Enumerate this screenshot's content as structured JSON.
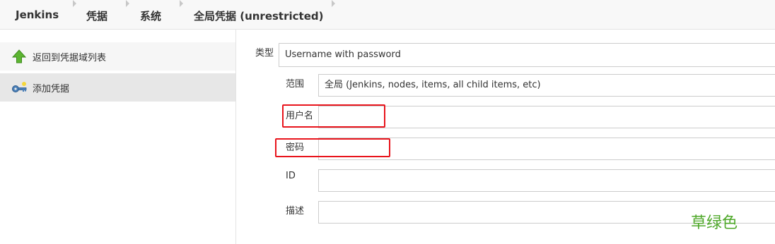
{
  "breadcrumbs": [
    {
      "label": "Jenkins"
    },
    {
      "label": "凭据"
    },
    {
      "label": "系统"
    },
    {
      "label": "全局凭据 (unrestricted)"
    }
  ],
  "sidebar": {
    "items": [
      {
        "label": "返回到凭据域列表",
        "icon": "up-arrow-icon"
      },
      {
        "label": "添加凭据",
        "icon": "key-icon"
      }
    ]
  },
  "form": {
    "kind_label": "类型",
    "kind_value": "Username with password",
    "scope_label": "范围",
    "scope_value": "全局 (Jenkins, nodes, items, all child items, etc)",
    "username_label": "用户名",
    "username_value": "",
    "password_label": "密码",
    "password_value": "",
    "id_label": "ID",
    "id_value": "",
    "description_label": "描述",
    "description_value": ""
  },
  "annotation": {
    "text": "草绿色",
    "color": "#4fa82a"
  },
  "colors": {
    "highlight": "#e8141c",
    "sidebar_active": "#e7e7e7"
  }
}
